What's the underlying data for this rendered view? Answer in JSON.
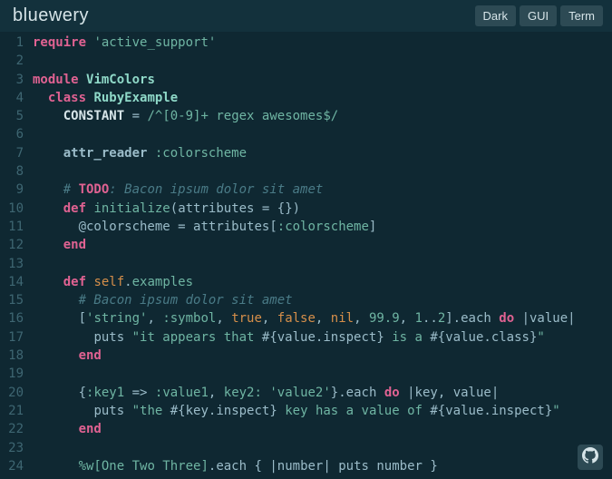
{
  "header": {
    "title": "bluewery",
    "buttons": {
      "dark": "Dark",
      "gui": "GUI",
      "term": "Term"
    }
  },
  "lines": [
    [
      {
        "c": "kw",
        "t": "require"
      },
      {
        "c": "op",
        "t": " "
      },
      {
        "c": "str",
        "t": "'active_support'"
      }
    ],
    [],
    [
      {
        "c": "kw",
        "t": "module"
      },
      {
        "c": "op",
        "t": " "
      },
      {
        "c": "mod",
        "t": "VimColors"
      }
    ],
    [
      {
        "c": "op",
        "t": "  "
      },
      {
        "c": "kw",
        "t": "class"
      },
      {
        "c": "op",
        "t": " "
      },
      {
        "c": "cls",
        "t": "RubyExample"
      }
    ],
    [
      {
        "c": "op",
        "t": "    "
      },
      {
        "c": "const",
        "t": "CONSTANT"
      },
      {
        "c": "op",
        "t": " = "
      },
      {
        "c": "regex",
        "t": "/"
      },
      {
        "c": "special",
        "t": "^["
      },
      {
        "c": "regex",
        "t": "0-9"
      },
      {
        "c": "special",
        "t": "]+"
      },
      {
        "c": "regex",
        "t": " regex awesomes"
      },
      {
        "c": "special",
        "t": "$"
      },
      {
        "c": "regex",
        "t": "/"
      }
    ],
    [],
    [
      {
        "c": "op",
        "t": "    "
      },
      {
        "c": "attr",
        "t": "attr_reader"
      },
      {
        "c": "op",
        "t": " "
      },
      {
        "c": "sym",
        "t": ":colorscheme"
      }
    ],
    [],
    [
      {
        "c": "op",
        "t": "    "
      },
      {
        "c": "cmt",
        "t": "# "
      },
      {
        "c": "todo",
        "t": "TODO"
      },
      {
        "c": "cmt",
        "t": ": Bacon ipsum dolor sit amet"
      }
    ],
    [
      {
        "c": "op",
        "t": "    "
      },
      {
        "c": "def",
        "t": "def"
      },
      {
        "c": "op",
        "t": " "
      },
      {
        "c": "fn",
        "t": "initialize"
      },
      {
        "c": "punct",
        "t": "("
      },
      {
        "c": "ident",
        "t": "attributes"
      },
      {
        "c": "op",
        "t": " = "
      },
      {
        "c": "punct",
        "t": "{})"
      }
    ],
    [
      {
        "c": "op",
        "t": "      "
      },
      {
        "c": "ivar",
        "t": "@colorscheme"
      },
      {
        "c": "op",
        "t": " = "
      },
      {
        "c": "ident",
        "t": "attributes"
      },
      {
        "c": "punct",
        "t": "["
      },
      {
        "c": "sym",
        "t": ":colorscheme"
      },
      {
        "c": "punct",
        "t": "]"
      }
    ],
    [
      {
        "c": "op",
        "t": "    "
      },
      {
        "c": "kw",
        "t": "end"
      }
    ],
    [],
    [
      {
        "c": "op",
        "t": "    "
      },
      {
        "c": "def",
        "t": "def"
      },
      {
        "c": "op",
        "t": " "
      },
      {
        "c": "self",
        "t": "self"
      },
      {
        "c": "punct",
        "t": "."
      },
      {
        "c": "fnself",
        "t": "examples"
      }
    ],
    [
      {
        "c": "op",
        "t": "      "
      },
      {
        "c": "cmt",
        "t": "# Bacon ipsum dolor sit amet"
      }
    ],
    [
      {
        "c": "op",
        "t": "      "
      },
      {
        "c": "punct",
        "t": "["
      },
      {
        "c": "str",
        "t": "'string'"
      },
      {
        "c": "punct",
        "t": ", "
      },
      {
        "c": "sym",
        "t": ":symbol"
      },
      {
        "c": "punct",
        "t": ", "
      },
      {
        "c": "bool",
        "t": "true"
      },
      {
        "c": "punct",
        "t": ", "
      },
      {
        "c": "bool",
        "t": "false"
      },
      {
        "c": "punct",
        "t": ", "
      },
      {
        "c": "bool",
        "t": "nil"
      },
      {
        "c": "punct",
        "t": ", "
      },
      {
        "c": "num",
        "t": "99.9"
      },
      {
        "c": "punct",
        "t": ", "
      },
      {
        "c": "num",
        "t": "1"
      },
      {
        "c": "punct",
        "t": ".."
      },
      {
        "c": "num",
        "t": "2"
      },
      {
        "c": "punct",
        "t": "]."
      },
      {
        "c": "ident",
        "t": "each"
      },
      {
        "c": "op",
        "t": " "
      },
      {
        "c": "kw",
        "t": "do"
      },
      {
        "c": "op",
        "t": " "
      },
      {
        "c": "punct",
        "t": "|"
      },
      {
        "c": "ident",
        "t": "value"
      },
      {
        "c": "punct",
        "t": "|"
      }
    ],
    [
      {
        "c": "op",
        "t": "        "
      },
      {
        "c": "ident",
        "t": "puts"
      },
      {
        "c": "op",
        "t": " "
      },
      {
        "c": "str",
        "t": "\"it appears that "
      },
      {
        "c": "interp",
        "t": "#{"
      },
      {
        "c": "ident",
        "t": "value"
      },
      {
        "c": "punct",
        "t": "."
      },
      {
        "c": "ident",
        "t": "inspect"
      },
      {
        "c": "interp",
        "t": "}"
      },
      {
        "c": "str",
        "t": " is a "
      },
      {
        "c": "interp",
        "t": "#{"
      },
      {
        "c": "ident",
        "t": "value"
      },
      {
        "c": "punct",
        "t": "."
      },
      {
        "c": "ident",
        "t": "class"
      },
      {
        "c": "interp",
        "t": "}"
      },
      {
        "c": "str",
        "t": "\""
      }
    ],
    [
      {
        "c": "op",
        "t": "      "
      },
      {
        "c": "kw",
        "t": "end"
      }
    ],
    [],
    [
      {
        "c": "op",
        "t": "      "
      },
      {
        "c": "punct",
        "t": "{"
      },
      {
        "c": "sym",
        "t": ":key1"
      },
      {
        "c": "op",
        "t": " => "
      },
      {
        "c": "sym",
        "t": ":value1"
      },
      {
        "c": "punct",
        "t": ", "
      },
      {
        "c": "sym",
        "t": "key2:"
      },
      {
        "c": "op",
        "t": " "
      },
      {
        "c": "str",
        "t": "'value2'"
      },
      {
        "c": "punct",
        "t": "}."
      },
      {
        "c": "ident",
        "t": "each"
      },
      {
        "c": "op",
        "t": " "
      },
      {
        "c": "kw",
        "t": "do"
      },
      {
        "c": "op",
        "t": " "
      },
      {
        "c": "punct",
        "t": "|"
      },
      {
        "c": "ident",
        "t": "key"
      },
      {
        "c": "punct",
        "t": ", "
      },
      {
        "c": "ident",
        "t": "value"
      },
      {
        "c": "punct",
        "t": "|"
      }
    ],
    [
      {
        "c": "op",
        "t": "        "
      },
      {
        "c": "ident",
        "t": "puts"
      },
      {
        "c": "op",
        "t": " "
      },
      {
        "c": "str",
        "t": "\"the "
      },
      {
        "c": "interp",
        "t": "#{"
      },
      {
        "c": "ident",
        "t": "key"
      },
      {
        "c": "punct",
        "t": "."
      },
      {
        "c": "ident",
        "t": "inspect"
      },
      {
        "c": "interp",
        "t": "}"
      },
      {
        "c": "str",
        "t": " key has a value of "
      },
      {
        "c": "interp",
        "t": "#{"
      },
      {
        "c": "ident",
        "t": "value"
      },
      {
        "c": "punct",
        "t": "."
      },
      {
        "c": "ident",
        "t": "inspect"
      },
      {
        "c": "interp",
        "t": "}"
      },
      {
        "c": "str",
        "t": "\""
      }
    ],
    [
      {
        "c": "op",
        "t": "      "
      },
      {
        "c": "kw",
        "t": "end"
      }
    ],
    [],
    [
      {
        "c": "op",
        "t": "      "
      },
      {
        "c": "special",
        "t": "%w["
      },
      {
        "c": "str",
        "t": "One Two Three"
      },
      {
        "c": "special",
        "t": "]"
      },
      {
        "c": "punct",
        "t": "."
      },
      {
        "c": "ident",
        "t": "each"
      },
      {
        "c": "op",
        "t": " "
      },
      {
        "c": "punct",
        "t": "{ |"
      },
      {
        "c": "ident",
        "t": "number"
      },
      {
        "c": "punct",
        "t": "| "
      },
      {
        "c": "ident",
        "t": "puts"
      },
      {
        "c": "op",
        "t": " "
      },
      {
        "c": "ident",
        "t": "number"
      },
      {
        "c": "op",
        "t": " "
      },
      {
        "c": "punct",
        "t": "}"
      }
    ]
  ]
}
